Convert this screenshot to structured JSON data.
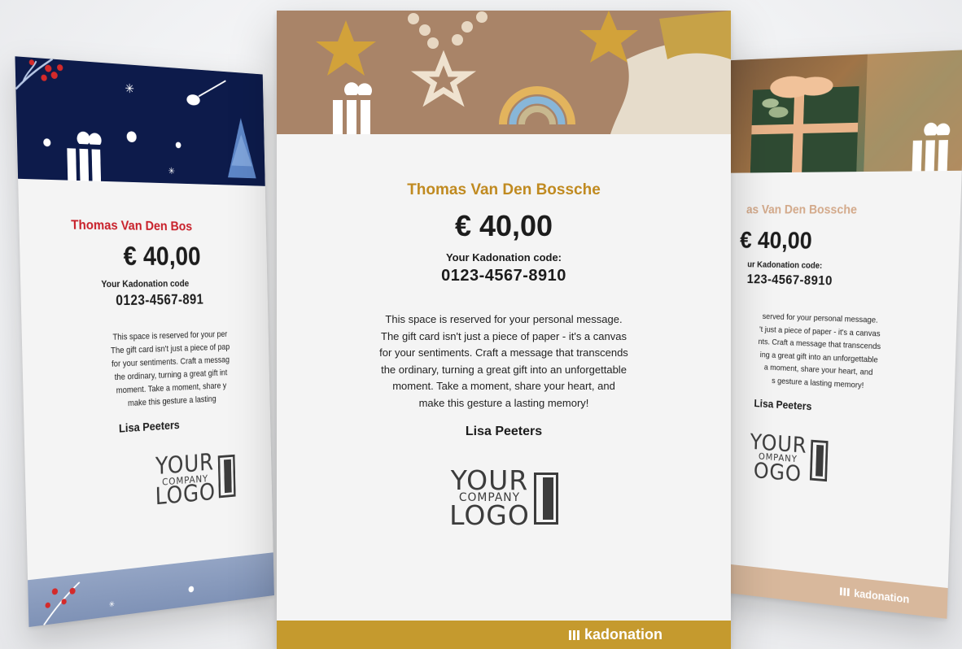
{
  "card": {
    "recipient": "Thomas Van Den Bossche",
    "recipient_right_visible": "as Van Den Bossche",
    "recipient_left_visible": "Thomas Van Den Bos",
    "amount": "€ 40,00",
    "code_label": "Your Kadonation code:",
    "code_label_right_visible": "ur Kadonation code:",
    "code_label_left_visible": "Your Kadonation code",
    "code": "0123-4567-8910",
    "code_left_visible": "0123-4567-891",
    "code_right_visible": "123-4567-8910",
    "message_lines": [
      "This space is reserved for your personal message.",
      "The gift card isn't just a piece of paper - it's a canvas",
      "for your sentiments. Craft a message that transcends",
      "the ordinary, turning a great gift into an unforgettable",
      "moment. Take a moment, share your heart, and",
      "make this gesture a lasting memory!"
    ],
    "message_lines_left_visible": [
      "This space is reserved for your per",
      "The gift card isn't just a piece of pap",
      "for your sentiments. Craft a messag",
      "the ordinary, turning a great gift int",
      "moment. Take a moment, share y",
      "make this gesture a lasting"
    ],
    "message_lines_right_visible": [
      "served for your personal message.",
      "'t just a piece of paper - it's a canvas",
      "nts. Craft a message that transcends",
      "ing a great gift into an unforgettable",
      "a moment, share your heart, and",
      "s gesture a lasting memory!"
    ],
    "signature": "Lisa Peeters",
    "logo": {
      "line1": "YOUR",
      "line2": "COMPANY",
      "line3": "LOGO"
    },
    "logo_right_visible": {
      "line1": "YOUR",
      "line2": "OMPANY",
      "line3": "OGO"
    },
    "brand": "kadonation"
  },
  "colors": {
    "left_accent": "#c8202a",
    "center_accent": "#c08a20",
    "right_accent": "#d8b89c",
    "left_banner": "#0d1b4b",
    "center_footer": "#c59a2e"
  }
}
